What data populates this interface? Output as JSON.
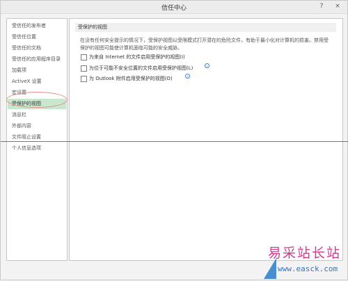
{
  "window": {
    "title": "信任中心",
    "help_symbol": "?",
    "close_symbol": "×"
  },
  "sidebar": {
    "items": [
      {
        "label": "受信任的发布者",
        "active": false
      },
      {
        "label": "受信任位置",
        "active": false
      },
      {
        "label": "受信任的文档",
        "active": false
      },
      {
        "label": "受信任的应用程序目录",
        "active": false
      },
      {
        "label": "加载项",
        "active": false
      },
      {
        "label": "ActiveX 设置",
        "active": false
      },
      {
        "label": "宏设置",
        "active": false
      },
      {
        "label": "受保护的视图",
        "active": true
      },
      {
        "label": "消息栏",
        "active": false
      },
      {
        "label": "外部内容",
        "active": false
      },
      {
        "label": "文件阻止设置",
        "active": false
      },
      {
        "label": "个人信息选项",
        "active": false
      }
    ]
  },
  "content": {
    "section_title": "受保护的视图",
    "description": "在没有任何安全提示的情况下，受保护视图以受限模式打开潜在的危险文件，有助于最小化对计算机的损害。禁用受保护的视图可能使计算机面临可能的安全威胁。",
    "options": [
      {
        "label": "为来自 Internet 的文件启用受保护的视图(I)",
        "checked": false,
        "info_icon": false
      },
      {
        "label": "为位于可能不安全位置的文件启用受保护视图(L)",
        "checked": false,
        "info_icon": true
      },
      {
        "label": "为 Outlook 附件启用受保护的视图(O)",
        "checked": false,
        "info_icon": true
      }
    ],
    "info_symbol": "i"
  },
  "watermark": {
    "title": "易采站长站",
    "url": "www.easck.com"
  },
  "colors": {
    "active_item_bg": "#c8e7cf",
    "highlight_ring": "#e58a8a",
    "guide_line": "#d94a4a",
    "watermark_title": "#d23b8c",
    "watermark_url": "#3b73b8"
  }
}
